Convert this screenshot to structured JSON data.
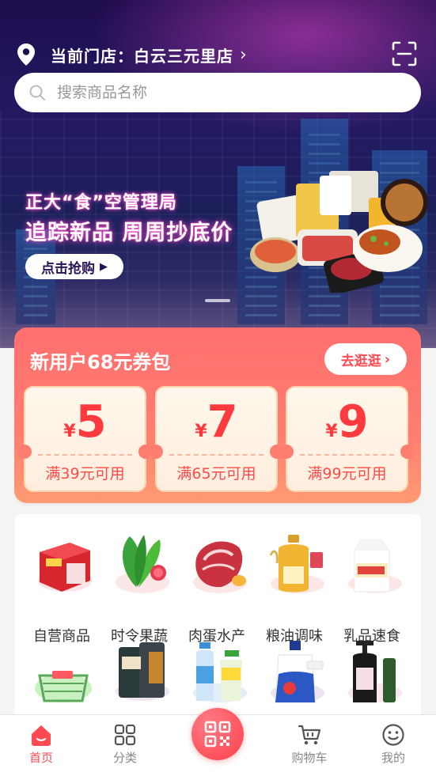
{
  "header": {
    "store_label": "当前门店：白云三元里店"
  },
  "search": {
    "placeholder": "搜索商品名称"
  },
  "banner": {
    "headline": "正大“食”空管理局",
    "subline": "追踪新品 周周抄底价",
    "cta": "点击抢购"
  },
  "coupon_pack": {
    "title": "新用户68元券包",
    "action": "去逛逛",
    "currency": "¥",
    "coupons": [
      {
        "amount": "5",
        "condition": "满39元可用"
      },
      {
        "amount": "7",
        "condition": "满65元可用"
      },
      {
        "amount": "9",
        "condition": "满99元可用"
      }
    ]
  },
  "categories": [
    {
      "label": "自营商品",
      "icon": "milk-gift-box-icon"
    },
    {
      "label": "时令果蔬",
      "icon": "vegetables-icon"
    },
    {
      "label": "肉蛋水产",
      "icon": "meat-icon"
    },
    {
      "label": "粮油调味",
      "icon": "cooking-oil-icon"
    },
    {
      "label": "乳品速食",
      "icon": "fresh-milk-icon"
    }
  ],
  "categories_row2_icons": [
    "basket-icon",
    "snacks-icon",
    "drinks-icon",
    "detergent-icon",
    "body-wash-icon"
  ],
  "nav": {
    "items": [
      {
        "label": "首页",
        "icon": "home-icon",
        "active": true
      },
      {
        "label": "分类",
        "icon": "category-grid-icon",
        "active": false
      },
      {
        "label": "购物车",
        "icon": "cart-icon",
        "active": false
      },
      {
        "label": "我的",
        "icon": "smiley-icon",
        "active": false
      }
    ],
    "center_icon": "qr-scan-icon"
  },
  "colors": {
    "brand_red": "#ff4a52",
    "coupon_panel": "#ff7e70"
  }
}
